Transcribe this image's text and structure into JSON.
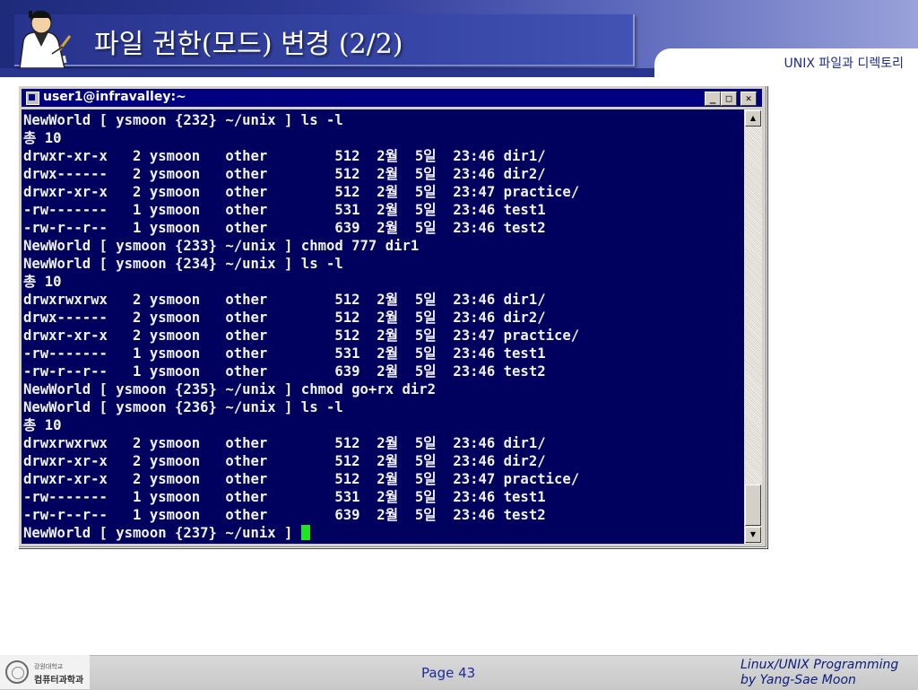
{
  "slide": {
    "title": "파일 권한(모드) 변경 (2/2)",
    "section_label": "UNIX 파일과 디렉토리",
    "logo_icon": "writer-at-desk-icon"
  },
  "terminal": {
    "window_title": "user1@infravalley:~",
    "buttons": {
      "minimize": "_",
      "maximize": "□",
      "close": "✕"
    },
    "lines": [
      "NewWorld [ ysmoon {232} ~/unix ] ls -l",
      "총 10",
      "drwxr-xr-x   2 ysmoon   other        512  2월  5일  23:46 dir1/",
      "drwx------   2 ysmoon   other        512  2월  5일  23:46 dir2/",
      "drwxr-xr-x   2 ysmoon   other        512  2월  5일  23:47 practice/",
      "-rw-------   1 ysmoon   other        531  2월  5일  23:46 test1",
      "-rw-r--r--   1 ysmoon   other        639  2월  5일  23:46 test2",
      "NewWorld [ ysmoon {233} ~/unix ] chmod 777 dir1",
      "NewWorld [ ysmoon {234} ~/unix ] ls -l",
      "총 10",
      "drwxrwxrwx   2 ysmoon   other        512  2월  5일  23:46 dir1/",
      "drwx------   2 ysmoon   other        512  2월  5일  23:46 dir2/",
      "drwxr-xr-x   2 ysmoon   other        512  2월  5일  23:47 practice/",
      "-rw-------   1 ysmoon   other        531  2월  5일  23:46 test1",
      "-rw-r--r--   1 ysmoon   other        639  2월  5일  23:46 test2",
      "NewWorld [ ysmoon {235} ~/unix ] chmod go+rx dir2",
      "NewWorld [ ysmoon {236} ~/unix ] ls -l",
      "총 10",
      "drwxrwxrwx   2 ysmoon   other        512  2월  5일  23:46 dir1/",
      "drwxr-xr-x   2 ysmoon   other        512  2월  5일  23:46 dir2/",
      "drwxr-xr-x   2 ysmoon   other        512  2월  5일  23:47 practice/",
      "-rw-------   1 ysmoon   other        531  2월  5일  23:46 test1",
      "-rw-r--r--   1 ysmoon   other        639  2월  5일  23:46 test2"
    ],
    "prompt": "NewWorld [ ysmoon {237} ~/unix ] ",
    "colors": {
      "background": "#00005e",
      "text": "#f2f2f2",
      "cursor": "#1fe41f"
    }
  },
  "footer": {
    "university": "강원대학교",
    "department": "컴퓨터과학과",
    "page": "Page 43",
    "credit_line1": "Linux/UNIX Programming",
    "credit_line2": "by Yang-Sae Moon"
  }
}
